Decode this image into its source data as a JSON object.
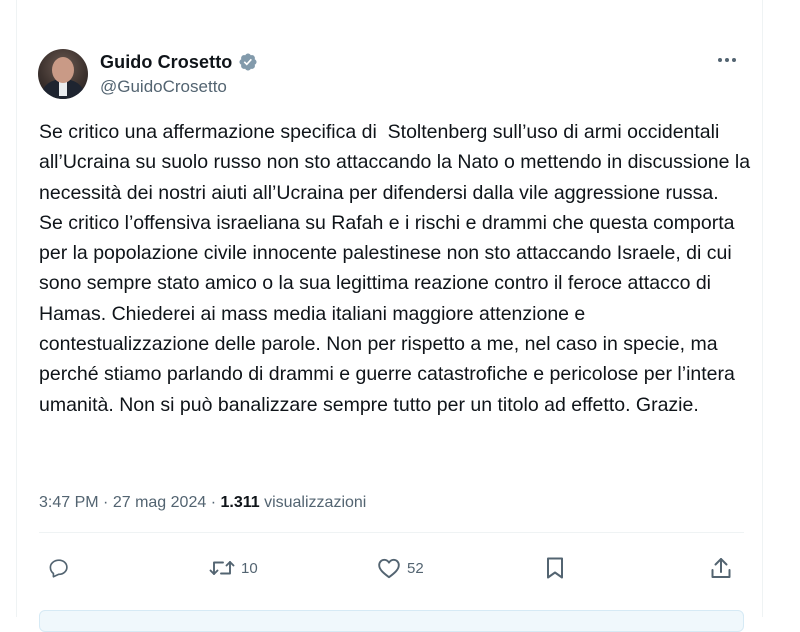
{
  "tweet": {
    "author": {
      "display_name": "Guido Crosetto",
      "handle": "@GuidoCrosetto",
      "verified_icon": "verified-badge-gray"
    },
    "text": "Se critico una affermazione specifica di  Stoltenberg sull’uso di armi occidentali all’Ucraina su suolo russo non sto attaccando la Nato o mettendo in discussione la necessità dei nostri aiuti all’Ucraina per difendersi dalla vile aggressione russa.\nSe critico l’offensiva israeliana su Rafah e i rischi e drammi che questa comporta per la popolazione civile innocente palestinese non sto attaccando Israele, di cui sono sempre stato amico o la sua legittima reazione contro il feroce attacco di Hamas. Chiederei ai mass media italiani maggiore attenzione e contestualizzazione delle parole. Non per rispetto a me, nel caso in specie, ma perché stiamo parlando di drammi e guerre catastrofiche e pericolose per l’intera umanità. Non si può banalizzare sempre tutto per un titolo ad effetto. Grazie.",
    "time": "3:47 PM",
    "separator": "·",
    "date": "27 mag 2024",
    "views_count": "1.311",
    "views_label": "visualizzazioni"
  },
  "actions": {
    "reply": {
      "icon": "reply-icon",
      "count": ""
    },
    "retweet": {
      "icon": "retweet-icon",
      "count": "10"
    },
    "like": {
      "icon": "heart-icon",
      "count": "52"
    },
    "bookmark": {
      "icon": "bookmark-icon"
    },
    "share": {
      "icon": "share-icon"
    }
  },
  "colors": {
    "text": "#0f1419",
    "secondary": "#536471",
    "verified_badge": "#829aab"
  }
}
